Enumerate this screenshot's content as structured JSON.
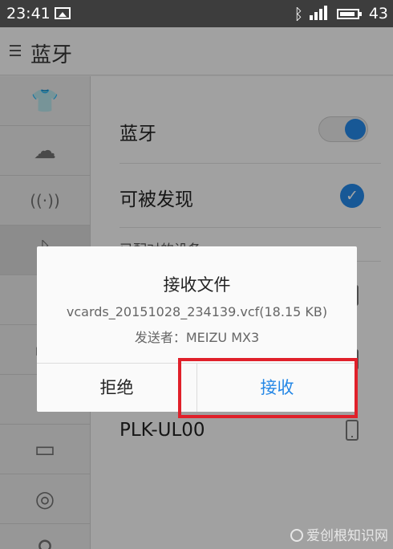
{
  "status_bar": {
    "time": "23:41",
    "battery_level": "43",
    "icons": [
      "gallery-icon",
      "bluetooth-icon",
      "signal-icon",
      "battery-icon"
    ]
  },
  "app_bar": {
    "title": "蓝牙",
    "menu_icon": "menu-icon"
  },
  "sidebar": {
    "items": [
      {
        "icon": "shirt-icon",
        "glyph": "👕"
      },
      {
        "icon": "cloud-icon",
        "glyph": "☁"
      },
      {
        "icon": "hotspot-icon",
        "glyph": "((·))"
      },
      {
        "icon": "bluetooth-icon",
        "glyph": "ᛒ"
      },
      {
        "icon": "wifi-icon",
        "glyph": "≋"
      },
      {
        "icon": "display-icon",
        "glyph": "▬"
      },
      {
        "icon": "sound-icon",
        "glyph": "♫"
      },
      {
        "icon": "battery-icon",
        "glyph": "▭"
      },
      {
        "icon": "fingerprint-icon",
        "glyph": "◎"
      },
      {
        "icon": "location-icon",
        "glyph": "⚲"
      }
    ]
  },
  "settings": {
    "bluetooth_label": "蓝牙",
    "bluetooth_enabled": true,
    "discoverable_label": "可被发现",
    "discoverable_checked": true,
    "paired_header": "已配对的设备",
    "device_name": "PLK-UL00"
  },
  "dialog": {
    "title": "接收文件",
    "file_info": "vcards_20151028_234139.vcf(18.15 KB)",
    "sender": "发送者：MEIZU MX3",
    "reject_label": "拒绝",
    "accept_label": "接收"
  },
  "colors": {
    "accent": "#2487e6",
    "highlight": "#e0202a",
    "status_bar": "#3d3d3d"
  },
  "watermark": {
    "text": "爱创根知识网"
  }
}
